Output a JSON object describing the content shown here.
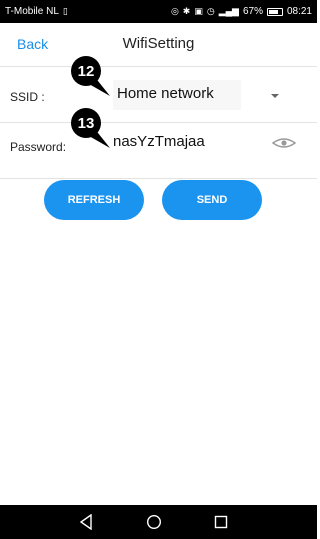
{
  "status_bar": {
    "carrier": "T-Mobile  NL",
    "battery_percent": "67%",
    "time": "08:21"
  },
  "header": {
    "back_label": "Back",
    "title": "WifiSetting"
  },
  "ssid": {
    "label": "SSID :",
    "value": "Home network"
  },
  "password": {
    "label": "Password:",
    "value": "nasYzTmajaa"
  },
  "callouts": [
    "12",
    "13"
  ],
  "buttons": {
    "refresh": "REFRESH",
    "send": "SEND"
  },
  "icons": {
    "status": [
      "sim-icon",
      "nfc-icon",
      "bluetooth-icon",
      "vibrate-icon",
      "alarm-icon",
      "signal-icon",
      "battery-icon"
    ],
    "navigation": [
      "back-nav-icon",
      "home-nav-icon",
      "recents-nav-icon"
    ],
    "eye": "eye-icon",
    "dropdown": "chevron-down-icon"
  },
  "colors": {
    "accent": "#1b94f0",
    "link": "#1a8fe8",
    "system_bars": "#000000",
    "callout": "#000000"
  }
}
